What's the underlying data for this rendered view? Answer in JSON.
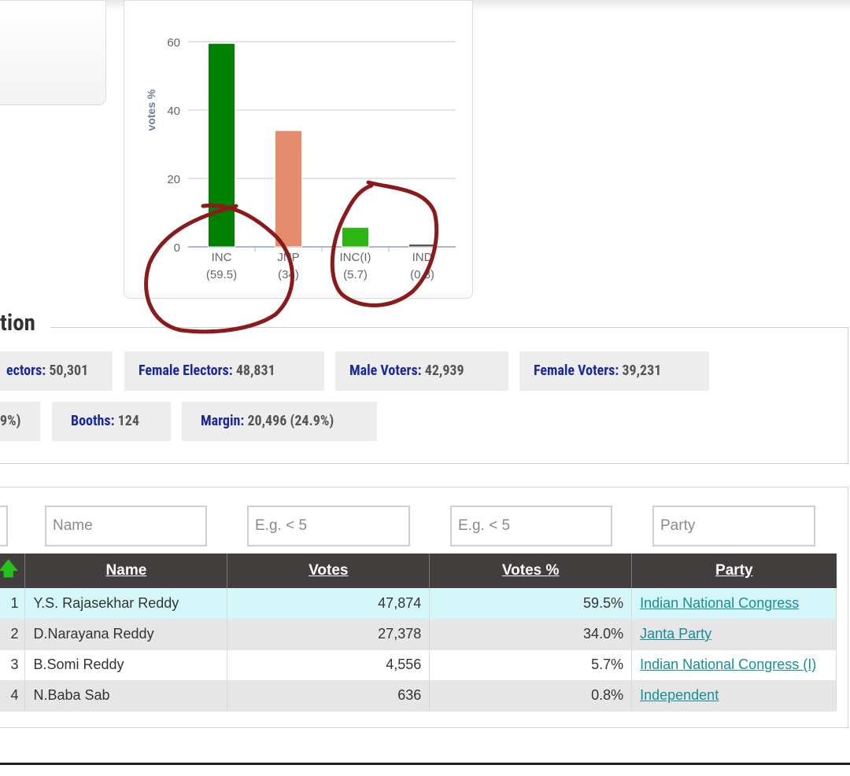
{
  "chart_data": {
    "type": "bar",
    "ylabel": "votes %",
    "ylim": [
      0,
      60
    ],
    "yticks": [
      "0",
      "20",
      "40",
      "60"
    ],
    "grid": true,
    "categories": [
      "INC",
      "JNP",
      "INC(I)",
      "IND"
    ],
    "category_sublabels": [
      "(59.5)",
      "(34)",
      "(5.7)",
      "(0.8)"
    ],
    "values": [
      59.5,
      34,
      5.7,
      0.8
    ],
    "colors": [
      "#008000",
      "#e58b6e",
      "#2db512",
      "#555555"
    ]
  },
  "section": {
    "title_fragment": "tion"
  },
  "stats_row1": [
    {
      "label": "ectors:",
      "value": " 50,301"
    },
    {
      "label": "Female Electors:",
      "value": " 48,831"
    },
    {
      "label": "Male Voters:",
      "value": " 42,939"
    },
    {
      "label": "Female Voters:",
      "value": " 39,231"
    }
  ],
  "stats_row2": [
    {
      "label": "",
      "value": "9%)"
    },
    {
      "label": "Booths:",
      "value": " 124"
    },
    {
      "label": "Margin:",
      "value": " 20,496 (24.9%)"
    }
  ],
  "filters": {
    "name_placeholder": "Name",
    "votes_placeholder": "E.g. < 5",
    "votes_pct_placeholder": "E.g. < 5",
    "party_placeholder": "Party"
  },
  "table": {
    "sort_icon": "up-arrow-icon",
    "sort_glyph": "🡅",
    "headers": {
      "name": "Name",
      "votes": "Votes",
      "votes_pct": "Votes %",
      "party": "Party"
    },
    "rows": [
      {
        "rank": "1",
        "name": "Y.S. Rajasekhar Reddy",
        "votes": "47,874",
        "votes_pct": "59.5%",
        "party": "Indian National Congress"
      },
      {
        "rank": "2",
        "name": "D.Narayana Reddy",
        "votes": "27,378",
        "votes_pct": "34.0%",
        "party": "Janta Party"
      },
      {
        "rank": "3",
        "name": "B.Somi Reddy",
        "votes": "4,556",
        "votes_pct": "5.7%",
        "party": "Indian National Congress (I)"
      },
      {
        "rank": "4",
        "name": "N.Baba Sab",
        "votes": "636",
        "votes_pct": "0.8%",
        "party": "Independent"
      }
    ]
  },
  "colors": {
    "header_bg": "#423e3d",
    "label_blue": "#1b2a9a",
    "link_teal": "#158f94",
    "highlight_row": "#d6f7fa",
    "annotation": "#8b1a1a"
  }
}
